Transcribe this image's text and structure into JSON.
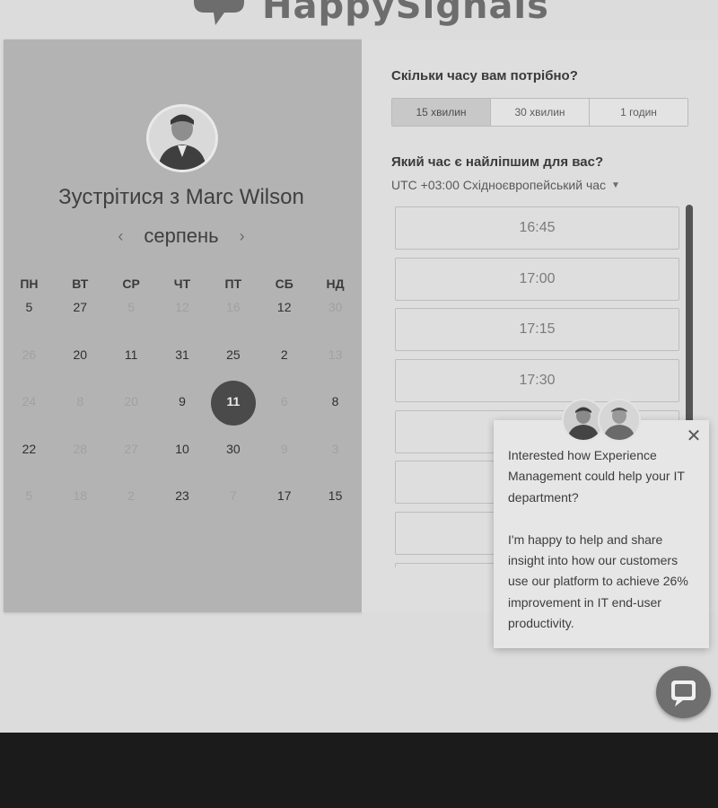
{
  "brand": {
    "name": "HappySignals",
    "logo_icon": "speech-bubble-logo-icon"
  },
  "meeting": {
    "title": "Зустрітися з Marc Wilson",
    "avatar_icon": "person-avatar"
  },
  "calendar": {
    "month": "серпень",
    "prev_icon": "chevron-left-icon",
    "next_icon": "chevron-right-icon",
    "weekdays": [
      "ПН",
      "ВТ",
      "СР",
      "ЧТ",
      "ПТ",
      "СБ",
      "НД"
    ],
    "weeks": [
      [
        {
          "d": "5",
          "a": true
        },
        {
          "d": "27",
          "a": true
        },
        {
          "d": "5",
          "a": false
        },
        {
          "d": "12",
          "a": false
        },
        {
          "d": "16",
          "a": false
        },
        {
          "d": "12",
          "a": true
        },
        {
          "d": "30",
          "a": false
        }
      ],
      [
        {
          "d": "26",
          "a": false
        },
        {
          "d": "20",
          "a": true
        },
        {
          "d": "11",
          "a": true
        },
        {
          "d": "31",
          "a": true
        },
        {
          "d": "25",
          "a": true
        },
        {
          "d": "2",
          "a": true
        },
        {
          "d": "13",
          "a": false
        }
      ],
      [
        {
          "d": "24",
          "a": false
        },
        {
          "d": "8",
          "a": false
        },
        {
          "d": "20",
          "a": false
        },
        {
          "d": "9",
          "a": true
        },
        {
          "d": "11",
          "a": true,
          "selected": true
        },
        {
          "d": "6",
          "a": false
        },
        {
          "d": "8",
          "a": true
        }
      ],
      [
        {
          "d": "22",
          "a": true
        },
        {
          "d": "28",
          "a": false
        },
        {
          "d": "27",
          "a": false
        },
        {
          "d": "10",
          "a": true
        },
        {
          "d": "30",
          "a": true
        },
        {
          "d": "9",
          "a": false
        },
        {
          "d": "3",
          "a": false
        }
      ],
      [
        {
          "d": "5",
          "a": false
        },
        {
          "d": "18",
          "a": false
        },
        {
          "d": "2",
          "a": false
        },
        {
          "d": "23",
          "a": true
        },
        {
          "d": "7",
          "a": false
        },
        {
          "d": "17",
          "a": true
        },
        {
          "d": "15",
          "a": true
        }
      ]
    ]
  },
  "duration": {
    "question": "Скільки часу вам потрібно?",
    "options": [
      {
        "label": "15 хвилин",
        "selected": true
      },
      {
        "label": "30 хвилин",
        "selected": false
      },
      {
        "label": "1 годин",
        "selected": false
      }
    ]
  },
  "time": {
    "question": "Який час є найліпшим для вас?",
    "timezone": "UTC +03:00 Східноєвропейський час",
    "timezone_caret_icon": "caret-down-icon",
    "slots": [
      "16:45",
      "17:00",
      "17:15",
      "17:30",
      "",
      "",
      "",
      ""
    ]
  },
  "chat_popup": {
    "close_icon": "close-icon",
    "paragraphs": [
      "Interested how Experience Management could help your IT department?",
      "I'm happy to help and share insight into how our customers use our platform to achieve 26% improvement in IT end-user productivity."
    ]
  },
  "chat_button": {
    "icon": "chat-bubble-icon"
  }
}
